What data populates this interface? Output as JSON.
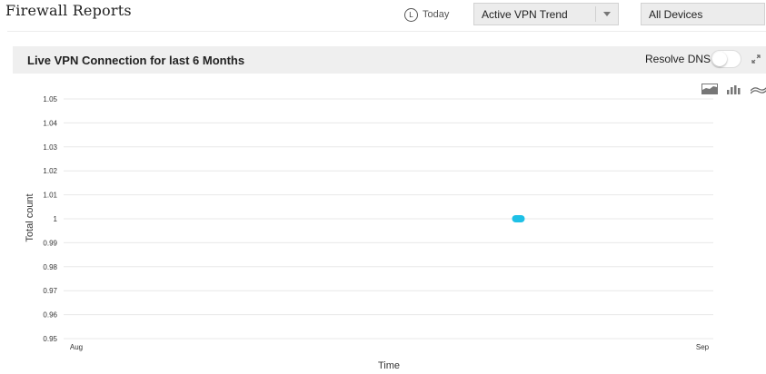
{
  "header": {
    "title": "Firewall Reports",
    "today_label": "Today",
    "clock_glyph": "L",
    "report_select": "Active VPN Trend",
    "device_select": "All Devices"
  },
  "panel": {
    "title": "Live VPN Connection for last 6 Months",
    "resolve_dns_label": "Resolve DNS",
    "resolve_dns_on": false
  },
  "icons": [
    "area-chart-icon",
    "bar-chart-icon",
    "line-chart-icon",
    "expand-icon"
  ],
  "colors": {
    "series": "#1ec0e6",
    "panel_bg": "#efefef",
    "grid": "#e8e8e8"
  },
  "chart_data": {
    "type": "line",
    "xlabel": "Time",
    "ylabel": "Total count",
    "x_ticks": [
      "Aug",
      "Sep"
    ],
    "y_ticks": [
      "0.95",
      "0.96",
      "0.97",
      "0.98",
      "0.99",
      "1",
      "1.01",
      "1.02",
      "1.03",
      "1.04",
      "1.05"
    ],
    "ylim": [
      0.95,
      1.05
    ],
    "grid": true,
    "series": [
      {
        "x_fraction": [
          0.7
        ],
        "values": [
          1
        ]
      }
    ]
  }
}
